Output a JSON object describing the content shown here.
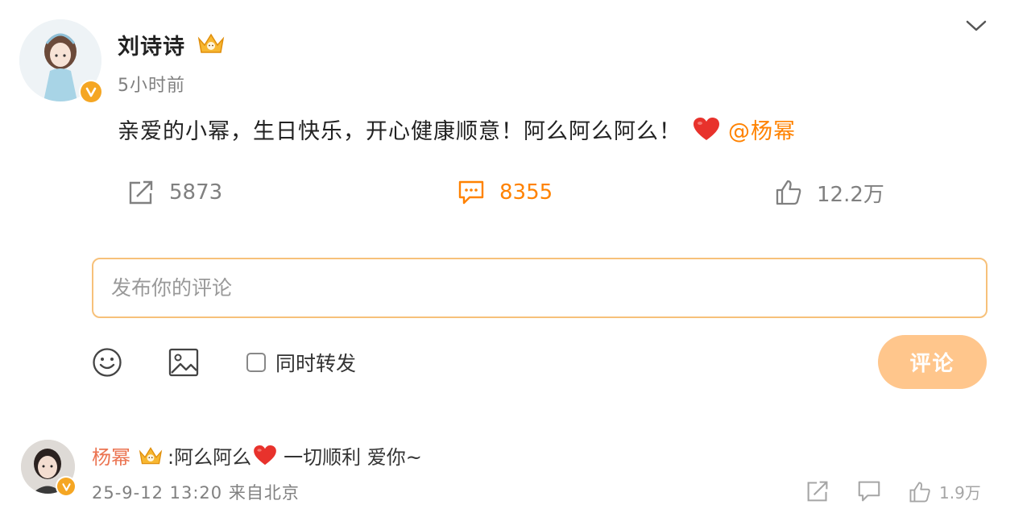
{
  "post": {
    "author": "刘诗诗",
    "time": "5小时前",
    "content_text": "亲爱的小幂，生日快乐，开心健康顺意！阿么阿么阿么！",
    "mention": "@杨幂",
    "actions": {
      "repost_count": "5873",
      "comment_count": "8355",
      "like_count": "12.2万"
    }
  },
  "composer": {
    "placeholder": "发布你的评论",
    "repost_label": "同时转发",
    "submit_label": "评论"
  },
  "reply": {
    "author": "杨幂",
    "text_before": ":阿么阿么",
    "text_after": "一切顺利 爱你~",
    "timestamp": "25-9-12 13:20 来自北京",
    "like_count": "1.9万"
  },
  "colors": {
    "accent": "#ff8200",
    "button_bg": "#ffc68c",
    "input_border": "#f7c17a",
    "verified": "#f5a623",
    "heart": "#e8322c"
  },
  "icons": [
    "dropdown-chevron-icon",
    "crown-badge-icon",
    "verified-v-icon",
    "heart-emoji-icon",
    "share-icon",
    "comment-icon",
    "like-icon",
    "emoji-icon",
    "image-icon"
  ]
}
